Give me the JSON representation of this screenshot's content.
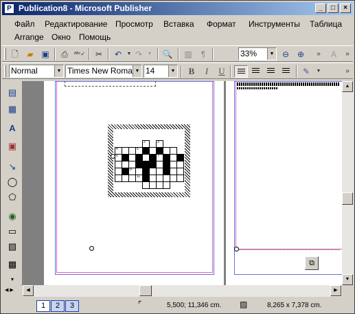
{
  "window": {
    "title": "Publication8 - Microsoft Publisher",
    "app_icon": "publisher-icon",
    "controls": [
      "minimize-icon",
      "maximize-icon",
      "close-icon"
    ]
  },
  "menu": [
    "Файл",
    "Редактирование",
    "Просмотр",
    "Вставка",
    "Формат",
    "Инструменты",
    "Таблица",
    "Arrange",
    "Окно",
    "Помощь"
  ],
  "standard_toolbar": {
    "zoom": "33%",
    "icons": [
      "new-icon",
      "open-icon",
      "save-icon",
      "print-icon",
      "spelling-icon",
      "cut-icon",
      "undo-icon",
      "redo-icon",
      "zoom-page-icon",
      "columns-icon",
      "pilcrow-icon",
      "zoom-out-icon",
      "zoom-in-icon"
    ]
  },
  "formatting_toolbar": {
    "style": "Normal",
    "font": "Times New Roman",
    "size": "14",
    "bold": "B",
    "italic": "I",
    "underline": "U",
    "alignment": "left"
  },
  "objects_toolbar": {
    "tools": [
      "text-box-icon",
      "table-icon",
      "wordart-icon",
      "picture-icon",
      "line-icon",
      "oval-icon",
      "shapes-icon",
      "hot-spot-icon",
      "form-control-icon",
      "html-fragment-icon",
      "design-gallery-icon"
    ]
  },
  "crossword": {
    "numbers": [
      "1",
      "2",
      "3",
      "4",
      "5",
      "6",
      "7",
      "8",
      "9",
      "10",
      "11"
    ]
  },
  "status": {
    "pages": [
      "1",
      "2",
      "3"
    ],
    "active_page": "1",
    "position": "5,500; 11,346 cm.",
    "size": "8,265 x  7,378 cm."
  }
}
